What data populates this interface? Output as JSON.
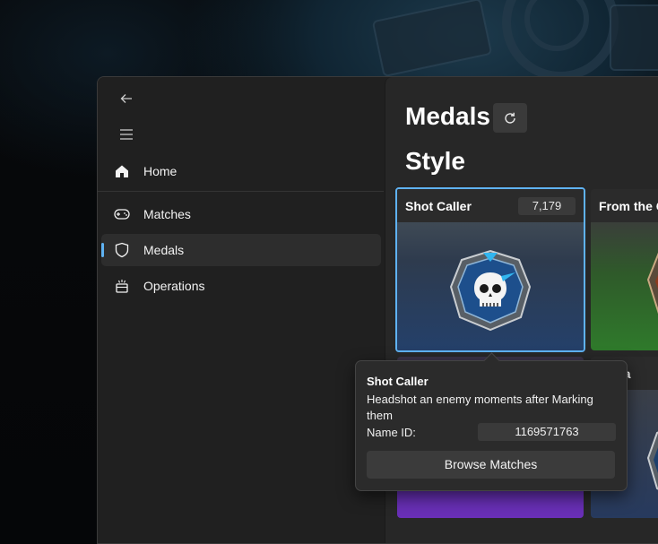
{
  "sidebar": {
    "back_icon": "back-arrow-icon",
    "menu_icon": "hamburger-menu-icon",
    "items": [
      {
        "label": "Home",
        "icon": "home-icon"
      },
      {
        "label": "Matches",
        "icon": "gamepad-icon"
      },
      {
        "label": "Medals",
        "icon": "shield-icon",
        "selected": true
      },
      {
        "label": "Operations",
        "icon": "operations-icon"
      }
    ]
  },
  "page": {
    "title": "Medals",
    "refresh_icon": "refresh-icon",
    "section": "Style"
  },
  "cards": [
    {
      "title": "Shot Caller",
      "count": "7,179",
      "selected": true
    },
    {
      "title": "From the G"
    },
    {
      "title": "ple-ja"
    }
  ],
  "tooltip": {
    "title": "Shot Caller",
    "description": "Headshot an enemy moments after Marking them",
    "name_id_label": "Name ID:",
    "name_id_value": "1169571763",
    "button_label": "Browse Matches"
  },
  "colors": {
    "accent": "#5fb2f2",
    "window_bg": "#202020",
    "content_bg": "#272727"
  }
}
